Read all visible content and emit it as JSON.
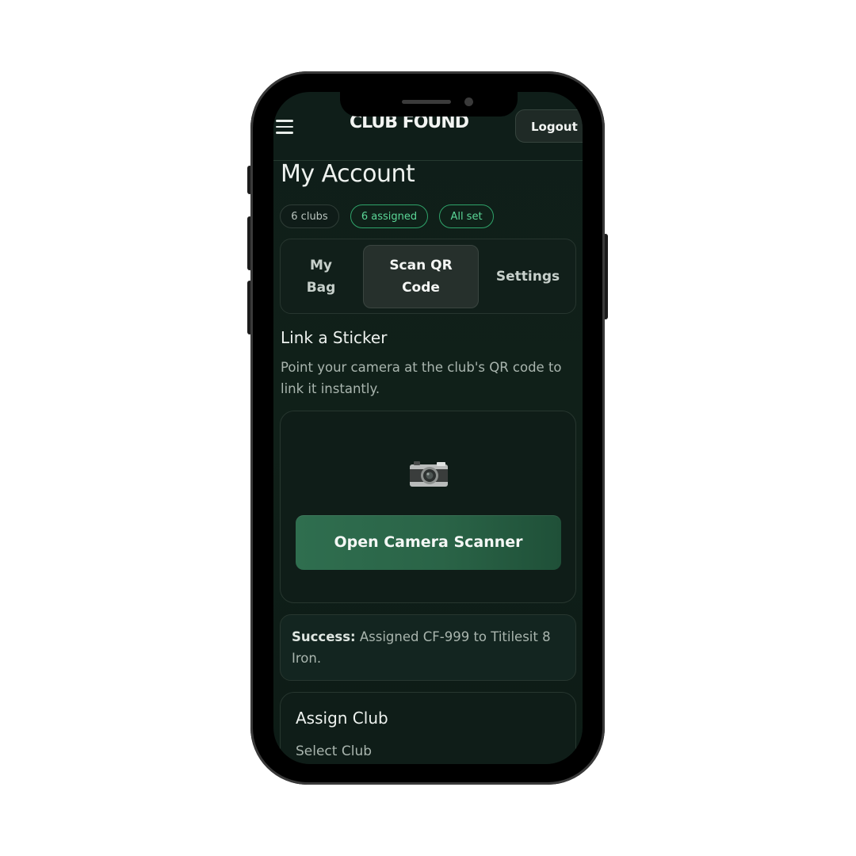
{
  "header": {
    "brand": "CLUB FOUND",
    "logout_label": "Logout"
  },
  "page": {
    "title": "My Account"
  },
  "stats": {
    "clubs": "6 clubs",
    "assigned": "6 assigned",
    "status": "All set"
  },
  "tabs": [
    {
      "label": "My Bag",
      "active": false
    },
    {
      "label": "Scan QR Code",
      "active": true
    },
    {
      "label": "Settings",
      "active": false
    }
  ],
  "scan": {
    "title": "Link a Sticker",
    "description": "Point your camera at the club's QR code to link it instantly.",
    "camera_icon": "camera-icon",
    "button_label": "Open Camera Scanner"
  },
  "success": {
    "label": "Success:",
    "message": " Assigned CF-999 to Titilesit 8 Iron."
  },
  "assign": {
    "title": "Assign Club",
    "select_label": "Select Club"
  },
  "colors": {
    "background": "#0f1e19",
    "accent": "#2fa36a",
    "button": "#2f6e4f"
  }
}
